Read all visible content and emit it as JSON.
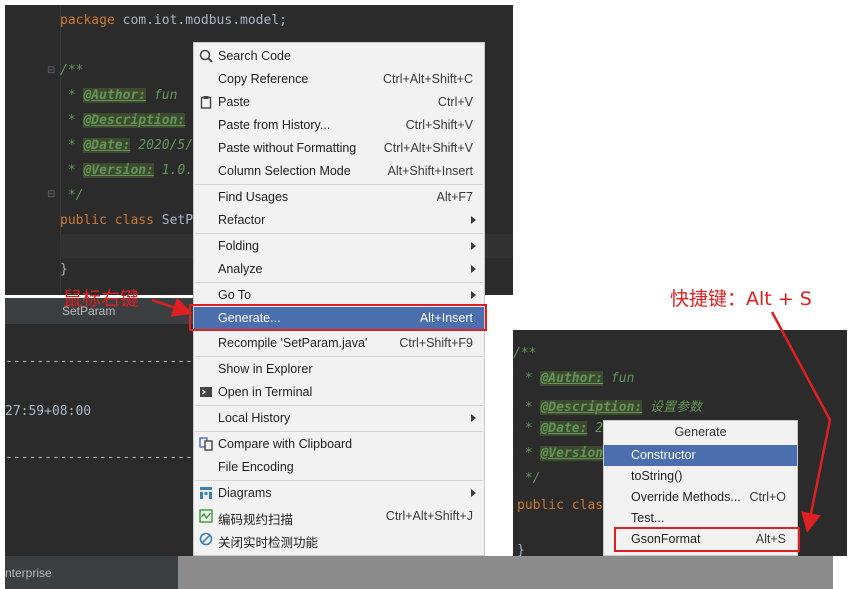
{
  "editor_top": {
    "package_kw": "package",
    "package_name": " com.iot.modbus.model;",
    "doc_open": "/**",
    "author_tag": "@Author:",
    "author_val": " fun",
    "desc_tag": "@Description:",
    "date_tag": "@Date:",
    "date_val": " 2020/5/",
    "version_tag": "@Version:",
    "version_val": " 1.0.",
    "doc_star": " * ",
    "doc_close": " */",
    "class_kw": "public class ",
    "class_name": "SetP",
    "brace_close": "}"
  },
  "file_tab": {
    "label": "SetParam"
  },
  "console": {
    "dashes": "------------------------------------------------------------",
    "timestamp": "27:59+08:00"
  },
  "status": {
    "text": "nterprise"
  },
  "context_menu": {
    "items": [
      {
        "label": "Search Code",
        "shortcut": "",
        "icon": "search-icon"
      },
      {
        "label": "Copy Reference",
        "shortcut": "Ctrl+Alt+Shift+C"
      },
      {
        "label": "Paste",
        "shortcut": "Ctrl+V",
        "icon": "clipboard-icon"
      },
      {
        "label": "Paste from History...",
        "shortcut": "Ctrl+Shift+V"
      },
      {
        "label": "Paste without Formatting",
        "shortcut": "Ctrl+Alt+Shift+V"
      },
      {
        "label": "Column Selection Mode",
        "shortcut": "Alt+Shift+Insert"
      },
      {
        "label": "Find Usages",
        "shortcut": "Alt+F7"
      },
      {
        "label": "Refactor",
        "shortcut": ""
      },
      {
        "label": "Folding",
        "shortcut": ""
      },
      {
        "label": "Analyze",
        "shortcut": ""
      },
      {
        "label": "Go To",
        "shortcut": ""
      },
      {
        "label": "Generate...",
        "shortcut": "Alt+Insert"
      },
      {
        "label": "Recompile 'SetParam.java'",
        "shortcut": "Ctrl+Shift+F9"
      },
      {
        "label": "Show in Explorer",
        "shortcut": ""
      },
      {
        "label": "Open in Terminal",
        "shortcut": "",
        "icon": "terminal-icon"
      },
      {
        "label": "Local History",
        "shortcut": ""
      },
      {
        "label": "Compare with Clipboard",
        "shortcut": "",
        "icon": "compare-icon"
      },
      {
        "label": "File Encoding",
        "shortcut": ""
      },
      {
        "label": "Diagrams",
        "shortcut": "",
        "icon": "diagram-icon"
      },
      {
        "label": "编码规约扫描",
        "shortcut": "Ctrl+Alt+Shift+J",
        "icon": "scan-icon"
      },
      {
        "label": "关闭实时检测功能",
        "shortcut": "",
        "icon": "block-icon"
      }
    ]
  },
  "editor_bottom": {
    "doc_open": "/**",
    "author_tag": "@Author:",
    "author_val": " fun",
    "desc_tag": "@Description:",
    "desc_val": " 设置参数",
    "date_tag": "@Date:",
    "date_val": " 2",
    "version_tag": "@Version",
    "doc_star": " * ",
    "doc_close": " */",
    "class_kw": "public clas",
    "brace_close": "}"
  },
  "generate_popup": {
    "title": "Generate",
    "items": [
      {
        "label": "Constructor",
        "shortcut": ""
      },
      {
        "label": "toString()",
        "shortcut": ""
      },
      {
        "label": "Override Methods...",
        "shortcut": "Ctrl+O"
      },
      {
        "label": "Test...",
        "shortcut": ""
      },
      {
        "label": "GsonFormat",
        "shortcut": "Alt+S"
      }
    ]
  },
  "annotations": {
    "right_click": "鼠标右键",
    "shortcut_note": "快捷键：Alt + S"
  },
  "colors": {
    "editor_bg": "#2b2b2b",
    "menu_bg": "#f2f2f2",
    "selection": "#4b6eaf",
    "annotation_red": "#e02020",
    "keyword": "#cc7832",
    "doc_green": "#629755"
  }
}
